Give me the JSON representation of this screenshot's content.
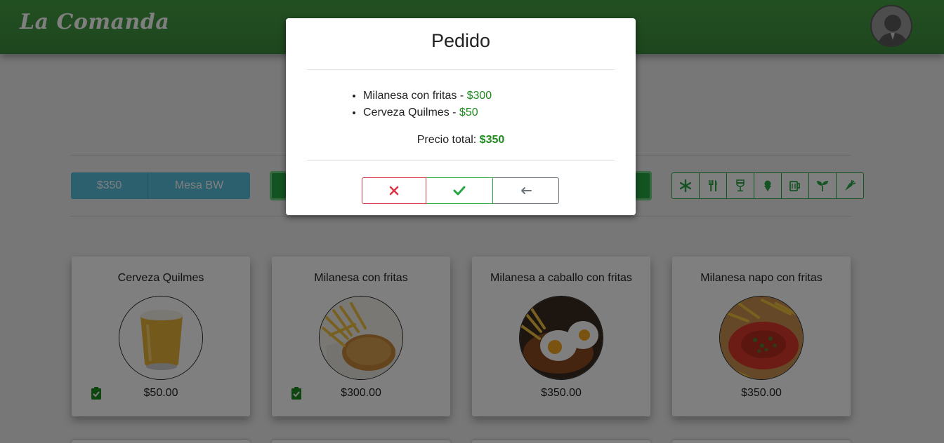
{
  "app": {
    "brand": "La Comanda"
  },
  "toolbar": {
    "total_button": "$350",
    "table_button": "Mesa BW"
  },
  "categories": [
    "all-icon",
    "utensils-icon",
    "wine-glass-icon",
    "ice-cream-icon",
    "beer-mug-icon",
    "seedling-icon",
    "carrot-icon"
  ],
  "products": [
    {
      "name": "Cerveza Quilmes",
      "price": "$50.00",
      "selected": true,
      "icon": "beer-glass-image"
    },
    {
      "name": "Milanesa con fritas",
      "price": "$300.00",
      "selected": true,
      "icon": "milanesa-fries-image"
    },
    {
      "name": "Milanesa a caballo con fritas",
      "price": "$350.00",
      "selected": false,
      "icon": "milanesa-eggs-image"
    },
    {
      "name": "Milanesa napo con fritas",
      "price": "$350.00",
      "selected": false,
      "icon": "milanesa-napo-image"
    }
  ],
  "modal": {
    "title": "Pedido",
    "items": [
      {
        "name": "Milanesa con fritas",
        "separator": " - ",
        "price": "$300"
      },
      {
        "name": "Cerveza Quilmes",
        "separator": " - ",
        "price": "$50"
      }
    ],
    "total_label": "Precio total:",
    "total_value": "$350",
    "actions": {
      "cancel": "close-icon",
      "confirm": "check-icon",
      "back": "arrow-left-icon"
    }
  },
  "colors": {
    "brand_green": "#3d8c3d",
    "info": "#5bc0de",
    "success": "#28a745",
    "danger": "#dc3545",
    "price_green": "#1e8a1e"
  }
}
